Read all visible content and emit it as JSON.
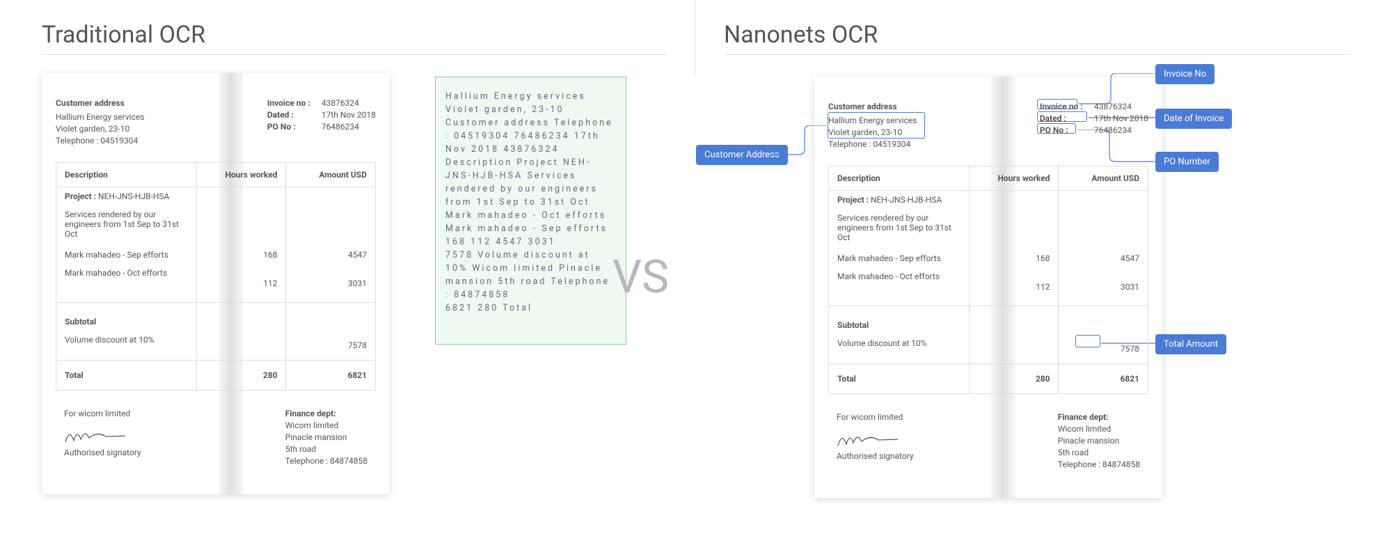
{
  "left_title": "Traditional OCR",
  "right_title": "Nanonets OCR",
  "vs": "VS",
  "invoice": {
    "cust_header": "Customer address",
    "cust_l1": "Hallium Energy services",
    "cust_l2": "Violet garden, 23-10",
    "cust_l3": "Telephone : 04519304",
    "invno_k": "Invoice no :",
    "invno_v": "43876324",
    "date_k": "Dated :",
    "date_v": "17th Nov 2018",
    "po_k": "PO No :",
    "po_v": "76486234",
    "th1": "Description",
    "th2": "Hours worked",
    "th3": "Amount USD",
    "proj_k": "Project :",
    "proj_v": "NEH-JNS-HJB-HSA",
    "desc_long": "Services rendered by our engineers from 1st Sep to 31st Oct",
    "r1d": "Mark mahadeo - Sep efforts",
    "r1h": "168",
    "r1a": "4547",
    "r2d": "Mark mahadeo - Oct efforts",
    "r2h": "112",
    "r2a": "3031",
    "sub_l": "Subtotal",
    "disc": "Volume discount at 10%",
    "disc_a": "7578",
    "tot_l": "Total",
    "tot_h": "280",
    "tot_a": "6821",
    "foot_l1": "For wicom limited",
    "foot_l2": "Authorised signatory",
    "fin_h": "Finance dept:",
    "fin_1": "Wicom limited",
    "fin_2": "Pinacle mansion",
    "fin_3": "5th road",
    "fin_4": "Telephone : 84874858"
  },
  "ocr_raw": "Hallium Energy services Violet garden, 23-10 Customer address Telephone : 04519304 76486234 17th Nov 2018 43876324\nDescription Project NEH-JNS-HJB-HSA Services rendered by our engineers from 1st Sep to 31st Oct\nMark mahadeo - Oct efforts Mark mahadeo - Sep efforts 168 112 4547 3031\n7578 Volume discount at 10% Wicom limited Pinacle mansion 5th road Telephone : 84874858\n6821 280 Total",
  "labels": {
    "cust": "Customer Address",
    "invno": "Invoice No",
    "date": "Date of Invoice",
    "po": "PO Number",
    "total": "Total Amount"
  }
}
